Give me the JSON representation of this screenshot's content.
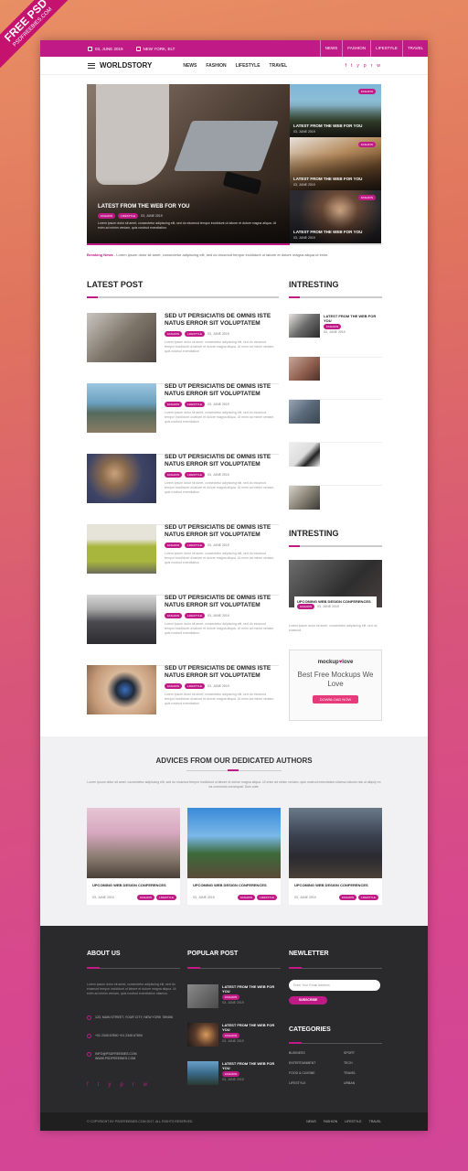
{
  "ribbon": {
    "title": "FREE PSD",
    "site": "PSDFREEBIES.COM"
  },
  "topbar": {
    "date": "03, JUNE 2019",
    "location": "NEW YORK, ELT",
    "nav": [
      "NEWS",
      "FASHION",
      "LIFESTYLE",
      "TRAVEL"
    ]
  },
  "header": {
    "logo": "WORLDSTORY",
    "nav": [
      "NEWS",
      "FASHION",
      "LIFESTYLE",
      "TRAVEL"
    ],
    "social": [
      "f",
      "t",
      "y",
      "p",
      "r",
      "w"
    ]
  },
  "hero": {
    "title": "LATEST FROM THE WEB FOR YOU",
    "tags": [
      "FASHION",
      "LIFESTYLE"
    ],
    "date": "03, JUNE 2019",
    "text": "Lorem ipsum dolor sit amet, consectetur adipiscing elit, sed do eiusmod tempor incididunt ut labore et dolore magna aliqua. Ut enim ad minim veniam, quis nostrud exercitation.",
    "side": [
      {
        "tag": "FASHION",
        "title": "LATEST FROM THE WEB FOR YOU",
        "date": "03, JUNE 2019"
      },
      {
        "tag": "FASHION",
        "title": "LATEST FROM THE WEB FOR YOU",
        "date": "03, JUNE 2019"
      },
      {
        "tag": "FASHION",
        "title": "LATEST FROM THE WEB FOR YOU",
        "date": "03, JUNE 2019"
      }
    ]
  },
  "breaking": {
    "label": "Breaking News",
    "text": " - Lorem ipsum dolor sit amet, consectetur adipiscing elit, sed do eiusmod tempor incididunt ut labore et dolore magna aliqua ut enim."
  },
  "latest": {
    "title": "LATEST POST",
    "posts": [
      {
        "title": "SED UT PERSICIATIS DE OMNIS ISTE NATUS ERROR SIT VOLUPTATEM",
        "tags": [
          "FASHION",
          "LIFESTYLE"
        ],
        "date": "03, JUNE 2019",
        "text": "Lorem ipsum dolor sit amet, consectetur adipiscing elit, sed do eiusmod tempor incididunt ut labore et dolore magna aliqua. Ut enim ad minim veniam, quis nostrud exercitation"
      },
      {
        "title": "SED UT PERSICIATIS DE OMNIS ISTE NATUS ERROR SIT VOLUPTATEM",
        "tags": [
          "FASHION",
          "LIFESTYLE"
        ],
        "date": "03, JUNE 2019",
        "text": "Lorem ipsum dolor sit amet, consectetur adipiscing elit, sed do eiusmod tempor incididunt ut labore et dolore magna aliqua. Ut enim ad minim veniam, quis nostrud exercitation"
      },
      {
        "title": "SED UT PERSICIATIS DE OMNIS ISTE NATUS ERROR SIT VOLUPTATEM",
        "tags": [
          "FASHION",
          "LIFESTYLE"
        ],
        "date": "03, JUNE 2019",
        "text": "Lorem ipsum dolor sit amet, consectetur adipiscing elit, sed do eiusmod tempor incididunt ut labore et dolore magna aliqua. Ut enim ad minim veniam, quis nostrud exercitation"
      },
      {
        "title": "SED UT PERSICIATIS DE OMNIS ISTE NATUS ERROR SIT VOLUPTATEM",
        "tags": [
          "FASHION",
          "LIFESTYLE"
        ],
        "date": "03, JUNE 2019",
        "text": "Lorem ipsum dolor sit amet, consectetur adipiscing elit, sed do eiusmod tempor incididunt ut labore et dolore magna aliqua. Ut enim ad minim veniam, quis nostrud exercitation"
      },
      {
        "title": "SED UT PERSICIATIS DE OMNIS ISTE NATUS ERROR SIT VOLUPTATEM",
        "tags": [
          "FASHION",
          "LIFESTYLE"
        ],
        "date": "03, JUNE 2019",
        "text": "Lorem ipsum dolor sit amet, consectetur adipiscing elit, sed do eiusmod tempor incididunt ut labore et dolore magna aliqua. Ut enim ad minim veniam, quis nostrud exercitation"
      },
      {
        "title": "SED UT PERSICIATIS DE OMNIS ISTE NATUS ERROR SIT VOLUPTATEM",
        "tags": [
          "FASHION",
          "LIFESTYLE"
        ],
        "date": "03, JUNE 2019",
        "text": "Lorem ipsum dolor sit amet, consectetur adipiscing elit, sed do eiusmod tempor incididunt ut labore et dolore magna aliqua. Ut enim ad minim veniam, quis nostrud exercitation"
      }
    ]
  },
  "interesting": {
    "title": "INTRESTING",
    "first": {
      "title": "LATEST FROM THE WEB FOR YOU",
      "tag": "FASHION",
      "date": "03, JUNE 2019"
    }
  },
  "interesting2": {
    "title": "INTRESTING",
    "title_card": "UPCOMING WEB DESIGN CONFERENCES",
    "tag": "FASHION",
    "date": "03, JUNE 2019",
    "text": "Lorem ipsum dolor sit amet, consectetur adipiscing elit, sed do eiusmod."
  },
  "ad": {
    "brand": "mockup",
    "brand2": "love",
    "tagline": "Best Free Mockups We Love",
    "button": "DOWNLOAD NOW"
  },
  "advices": {
    "title": "ADVICES FROM OUR DEDICATED AUTHORS",
    "intro": "Lorem ipsum dolor sit amet, consectetur adipiscing elit, sed do eiusmod tempor incididunt ut labore et dolore magna aliqua. Ut enim ad minim veniam, quis nostrud exercitation ullamco laboris nisi ut aliquip ex ea commodo consequat. Duis aute.",
    "cards": [
      {
        "title": "UPCOMING WEB DESIGN CONFERENCES",
        "date": "03, JUNE 2019",
        "tags": [
          "FASHION",
          "LIFESTYLE"
        ]
      },
      {
        "title": "UPCOMING WEB DESIGN CONFERENCES",
        "date": "03, JUNE 2019",
        "tags": [
          "FASHION",
          "LIFESTYLE"
        ]
      },
      {
        "title": "UPCOMING WEB DESIGN CONFERENCES",
        "date": "03, JUNE 2019",
        "tags": [
          "FASHION",
          "LIFESTYLE"
        ]
      }
    ]
  },
  "footer": {
    "about_title": "ABOUT US",
    "about_text": "Lorem ipsum dolor sit amet, consectetur adipiscing elit, sed do eiusmod tempor incididunt ut labore et dolore magna aliqua. Ut enim ad minim veniam, quis nostrud exercitation ullamco.",
    "address": "123, MAIN STREET, YOUR CITY, NEW YORK 789456",
    "phone": "+01 2345 67890 +01 2345 67890",
    "email": "INFO@PSDFREEBIES.COM WWW.PSDFREEBIES.COM",
    "popular_title": "POPULAR POST",
    "popular": [
      {
        "title": "LATEST FROM THE WEB FOR YOU",
        "tag": "FASHION",
        "date": "03, JUNE 2019"
      },
      {
        "title": "LATEST FROM THE WEB FOR YOU",
        "tag": "FASHION",
        "date": "03, JUNE 2019"
      },
      {
        "title": "LATEST FROM THE WEB FOR YOU",
        "tag": "FASHION",
        "date": "03, JUNE 2019"
      }
    ],
    "newsletter_title": "NEWLETTER",
    "newsletter_placeholder": "Enter Your Email Address",
    "subscribe": "SUBSCRIBE",
    "categories_title": "CATEGORIES",
    "categories": [
      "BUSINESS",
      "SPORT",
      "ENTERTAINMENT",
      "TECH",
      "FOOD & CUISINE",
      "TRAVEL",
      "LIFESTYLE",
      "URBAN"
    ],
    "copyright": "© COPYRIGHT BY PSDFREEBIES.COM 2017. ALL RIGHTS RESERVED.",
    "bottom_nav": [
      "NEWS",
      "FASHION",
      "LIFESTYLE",
      "TRAVEL"
    ]
  },
  "colors": {
    "accent": "#c01a86",
    "footer": "#2a2a2c"
  }
}
